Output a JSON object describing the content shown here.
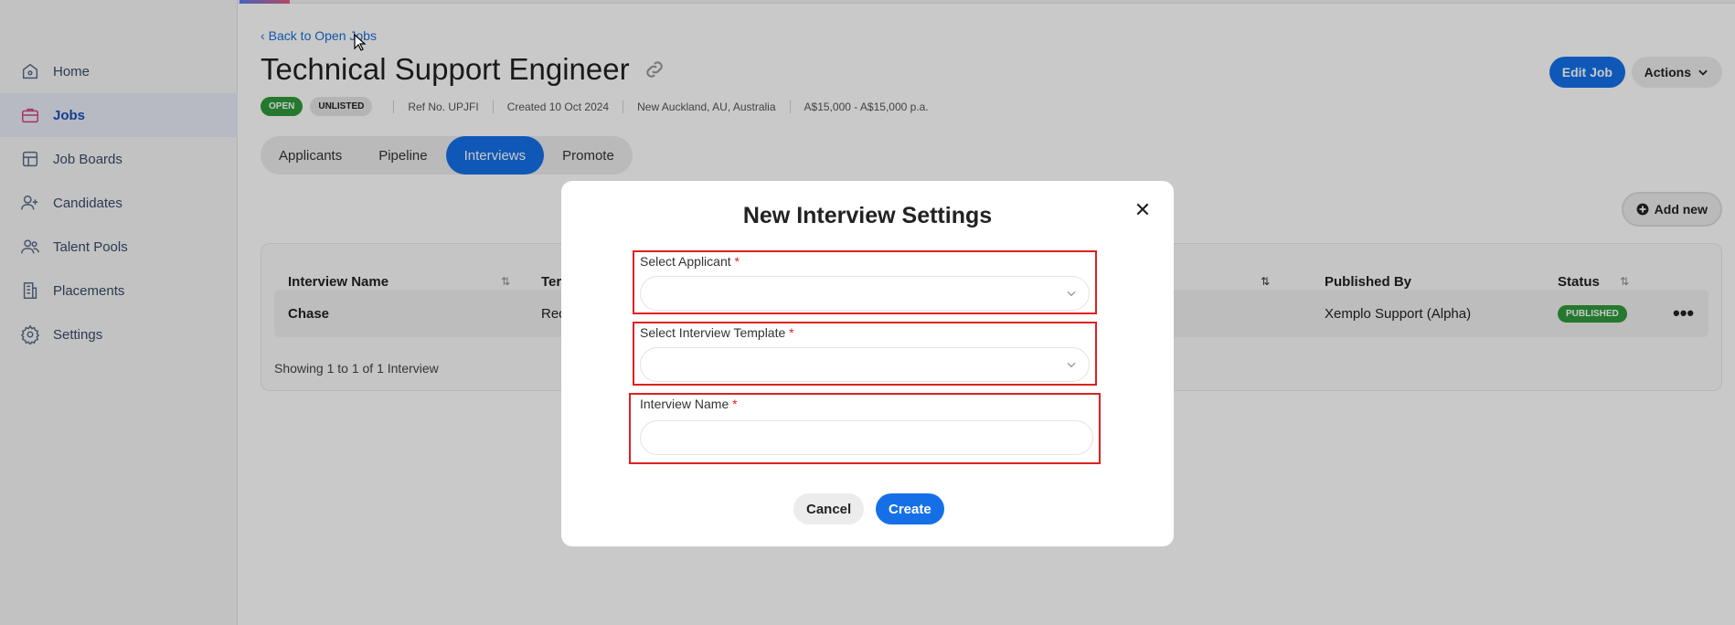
{
  "sidebar": {
    "items": [
      {
        "label": "Home",
        "icon": "home-icon"
      },
      {
        "label": "Jobs",
        "icon": "briefcase-icon",
        "active": true
      },
      {
        "label": "Job Boards",
        "icon": "board-icon"
      },
      {
        "label": "Candidates",
        "icon": "add-person-icon"
      },
      {
        "label": "Talent Pools",
        "icon": "people-icon"
      },
      {
        "label": "Placements",
        "icon": "building-icon"
      },
      {
        "label": "Settings",
        "icon": "gear-icon"
      }
    ]
  },
  "header": {
    "back_label": "Back to Open Jobs",
    "title": "Technical Support Engineer",
    "badges": {
      "open": "OPEN",
      "unlisted": "UNLISTED"
    },
    "ref": "Ref No. UPJFI",
    "created": "Created 10 Oct 2024",
    "location": "New Auckland, AU, Australia",
    "salary": "A$15,000 - A$15,000 p.a.",
    "edit_label": "Edit Job",
    "actions_label": "Actions"
  },
  "tabs": [
    {
      "label": "Applicants"
    },
    {
      "label": "Pipeline"
    },
    {
      "label": "Interviews",
      "active": true
    },
    {
      "label": "Promote"
    }
  ],
  "add_new_label": "Add new",
  "table": {
    "columns": {
      "name": "Interview Name",
      "template": "Ter",
      "published_by": "Published By",
      "status": "Status"
    },
    "rows": [
      {
        "name": "Chase",
        "template": "Rec",
        "published_by": "Xemplo Support (Alpha)",
        "status": "PUBLISHED"
      }
    ],
    "footer": "Showing 1 to 1 of 1 Interview"
  },
  "modal": {
    "title": "New Interview Settings",
    "close": "✕",
    "fields": {
      "applicant": {
        "label": "Select Applicant",
        "required": "*",
        "value": ""
      },
      "template": {
        "label": "Select Interview Template",
        "required": "*",
        "value": ""
      },
      "name": {
        "label": "Interview Name",
        "required": "*",
        "value": "",
        "placeholder": ""
      }
    },
    "cancel_label": "Cancel",
    "create_label": "Create"
  },
  "colors": {
    "primary": "#1570e8",
    "success": "#2e9a3b",
    "required": "#e02020"
  }
}
